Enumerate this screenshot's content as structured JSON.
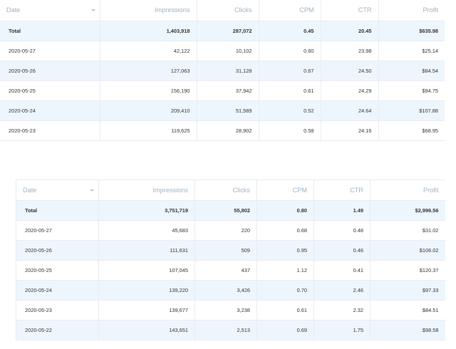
{
  "columns": [
    "Date",
    "Impressions",
    "Clicks",
    "CPM",
    "CTR",
    "Profit"
  ],
  "table1": {
    "rows": [
      [
        "Total",
        "1,403,918",
        "287,072",
        "0.45",
        "20.45",
        "$635.98"
      ],
      [
        "2020-05-27",
        "42,122",
        "10,102",
        "0.60",
        "23.98",
        "$25.14"
      ],
      [
        "2020-05-26",
        "127,063",
        "31,128",
        "0.67",
        "24.50",
        "$84.54"
      ],
      [
        "2020-05-25",
        "156,190",
        "37,942",
        "0.61",
        "24.29",
        "$94.75"
      ],
      [
        "2020-05-24",
        "209,410",
        "51,589",
        "0.52",
        "24.64",
        "$107.88"
      ],
      [
        "2020-05-23",
        "119,625",
        "28,902",
        "0.58",
        "24.16",
        "$68.95"
      ]
    ]
  },
  "table2": {
    "rows": [
      [
        "Total",
        "3,751,719",
        "55,802",
        "0.80",
        "1.49",
        "$2,996.56"
      ],
      [
        "2020-05-27",
        "45,683",
        "220",
        "0.68",
        "0.48",
        "$31.02"
      ],
      [
        "2020-05-26",
        "111,631",
        "509",
        "0.95",
        "0.46",
        "$106.02"
      ],
      [
        "2020-05-25",
        "107,045",
        "437",
        "1.12",
        "0.41",
        "$120.37"
      ],
      [
        "2020-05-24",
        "139,220",
        "3,426",
        "0.70",
        "2.46",
        "$97.33"
      ],
      [
        "2020-05-23",
        "139,677",
        "3,238",
        "0.61",
        "2.32",
        "$84.51"
      ],
      [
        "2020-05-22",
        "143,651",
        "2,513",
        "0.69",
        "1.75",
        "$98.58"
      ]
    ]
  }
}
